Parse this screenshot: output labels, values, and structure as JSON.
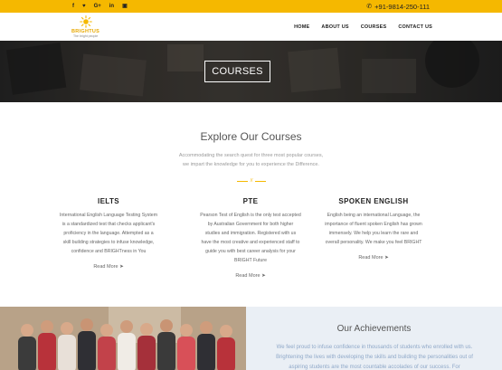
{
  "topbar": {
    "socials": [
      {
        "icon": "facebook-icon",
        "glyph": "f"
      },
      {
        "icon": "twitter-icon",
        "glyph": "♥"
      },
      {
        "icon": "google-plus-icon",
        "glyph": "G+"
      },
      {
        "icon": "linkedin-icon",
        "glyph": "in"
      },
      {
        "icon": "instagram-icon",
        "glyph": "▣"
      }
    ],
    "phone": "+91-9814-250-111",
    "accent": "#f5b800"
  },
  "nav": {
    "logo_name": "BRIGHTUS",
    "logo_tagline": "The bright people",
    "items": [
      "HOME",
      "ABOUT US",
      "COURSES",
      "CONTACT US"
    ]
  },
  "hero": {
    "title": "COURSES"
  },
  "explore": {
    "title": "Explore Our Courses",
    "subtitle_1": "Accommodating the search quest for three most popular courses,",
    "subtitle_2": "we impart the knowledge for you to experience the Difference.",
    "divider_mark": "//"
  },
  "courses": [
    {
      "title": "IELTS",
      "lines": [
        "International English Language Testing System",
        "is a standardized test that checks applicant's",
        "proficiency in the language. Attempted as a",
        "skill building strategies to infuse knowledge,",
        "confidence and BRIGHTness in You"
      ],
      "readmore": "Read More"
    },
    {
      "title": "PTE",
      "lines": [
        "Pearson Test of English is the only test accepted",
        "by Australian Government for both higher",
        "studies and immigration. Registered with us",
        "have the most creative and experienced staff to",
        "guide you with best career analysis for your",
        "BRIGHT Future"
      ],
      "readmore": "Read More"
    },
    {
      "title": "SPOKEN ENGLISH",
      "lines": [
        "English being an international Language, the",
        "importance of fluent spoken English has grown",
        "immensely. We help you learn the rare and",
        "overall personality. We make you feel BRIGHT"
      ],
      "readmore": "Read More"
    }
  ],
  "achievements": {
    "title": "Our Achievements",
    "lines": [
      "We feel proud to infuse confidence in thousands of students who enrolled with us.",
      "Brightening the lives with developing the skills and building the personalities out of",
      "aspiring students are the most countable accolades of our success. For"
    ]
  }
}
